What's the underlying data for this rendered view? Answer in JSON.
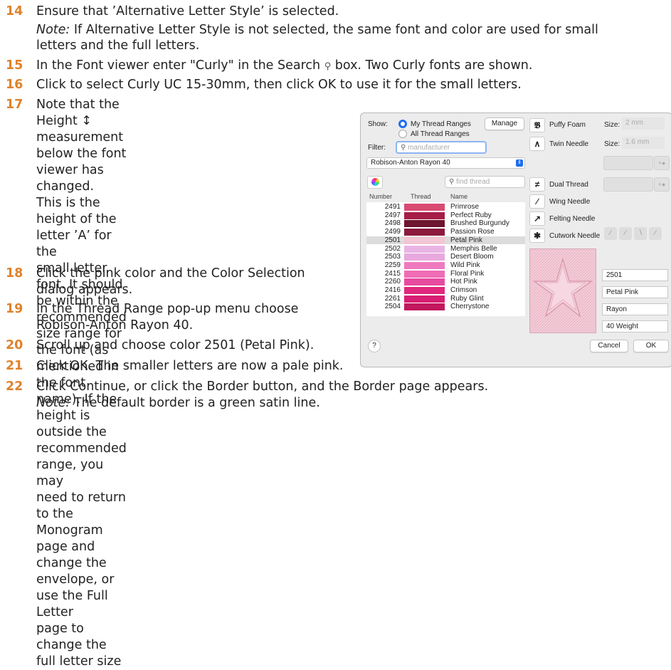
{
  "steps": [
    {
      "n": "14",
      "text": "Ensure that ’Alternative Letter Style’ is selected."
    },
    {
      "n": "15",
      "text": "In the Font viewer enter \"Curly\" in the Search  box. Two Curly fonts are shown."
    },
    {
      "n": "16",
      "text": "Click to select Curly UC 15-30mm, then click OK to use it for the small letters."
    },
    {
      "n": "17",
      "lines": [
        "Note that the Height ↕ measurement",
        "below the font viewer has changed.",
        "This is the height of the letter ’A’ for the",
        "small letter font. It should be within the",
        "recommended size range for the font (as",
        "mentioned in the font name). If the height is",
        "outside the recommended range, you may",
        "need to return to the Monogram page and",
        "change the envelope, or use the Full Letter",
        "page to change the full letter size"
      ]
    },
    {
      "n": "18",
      "lines": [
        "Click the pink color and the Color Selection",
        "dialog appears."
      ]
    },
    {
      "n": "19",
      "lines": [
        "In the Thread Range pop-up menu choose",
        "Robison-Anton Rayon 40."
      ]
    },
    {
      "n": "20",
      "text": "Scroll up and choose color 2501 (Petal Pink)."
    },
    {
      "n": "21",
      "text": "Click OK. The smaller letters are now a pale pink."
    },
    {
      "n": "22",
      "text": "Click Continue, or click the Border button, and the Border page appears."
    }
  ],
  "notes": {
    "n14_label": "Note:",
    "n14_line1": " If Alternative Letter Style is not selected, the same font and color are used for small",
    "n14_line2": "letters and the full letters.",
    "n22_label": "Note:",
    "n22_text": " The default border is a green satin line."
  },
  "dialog": {
    "show_label": "Show:",
    "radio_my": "My Thread Ranges",
    "radio_all": "All Thread Ranges",
    "manage": "Manage",
    "filter_label": "Filter:",
    "filter_placeholder": "manufacturer",
    "range_select": "Robison-Anton Rayon 40",
    "find_placeholder": "find thread",
    "col_number": "Number",
    "col_thread": "Thread",
    "col_name": "Name",
    "threads": [
      {
        "num": "2491",
        "name": "Primrose",
        "color": "#d94a72"
      },
      {
        "num": "2497",
        "name": "Perfect Ruby",
        "color": "#a51d46"
      },
      {
        "num": "2498",
        "name": "Brushed Burgundy",
        "color": "#6e1530"
      },
      {
        "num": "2499",
        "name": "Passion Rose",
        "color": "#8b1a3d"
      },
      {
        "num": "2501",
        "name": "Petal Pink",
        "color": "#f2c6d4"
      },
      {
        "num": "2502",
        "name": "Memphis Belle",
        "color": "#e9b4e4"
      },
      {
        "num": "2503",
        "name": "Desert Bloom",
        "color": "#e8a8de"
      },
      {
        "num": "2259",
        "name": "Wild Pink",
        "color": "#f07ac0"
      },
      {
        "num": "2415",
        "name": "Floral Pink",
        "color": "#f06cb5"
      },
      {
        "num": "2260",
        "name": "Hot Pink",
        "color": "#e84aa0"
      },
      {
        "num": "2416",
        "name": "Crimson",
        "color": "#e0287e"
      },
      {
        "num": "2261",
        "name": "Ruby Glint",
        "color": "#d81e72"
      },
      {
        "num": "2504",
        "name": "Cherrystone",
        "color": "#c2185e"
      }
    ],
    "tools": {
      "puffy": "Puffy Foam",
      "twin": "Twin Needle",
      "dual": "Dual Thread",
      "wing": "Wing Needle",
      "felting": "Felting Needle",
      "cutwork": "Cutwork Needle",
      "size_label": "Size:",
      "size_puffy": "2 mm",
      "size_twin": "1.6 mm"
    },
    "info": {
      "number": "2501",
      "name": "Petal Pink",
      "type": "Rayon",
      "weight": "40 Weight"
    },
    "help": "?",
    "cancel": "Cancel",
    "ok": "OK"
  }
}
